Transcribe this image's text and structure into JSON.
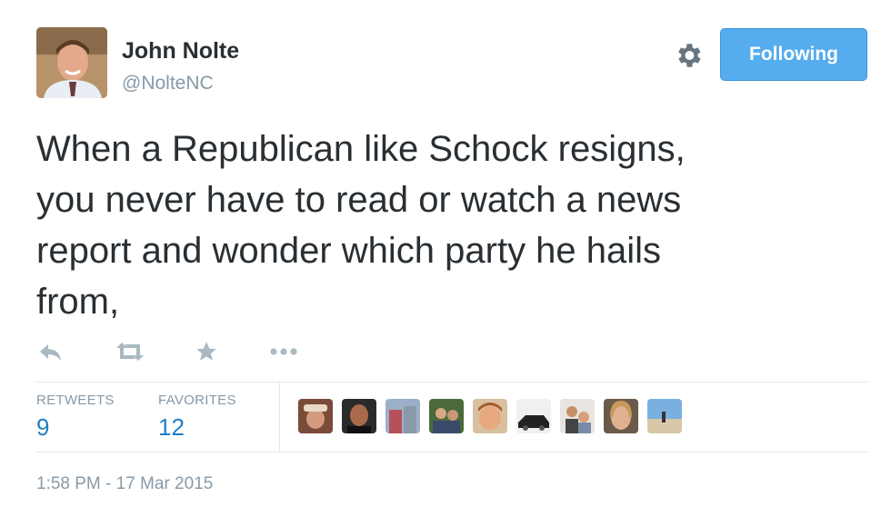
{
  "author": {
    "name": "John Nolte",
    "handle": "@NolteNC"
  },
  "follow_button": {
    "label": "Following",
    "color": "#55acee"
  },
  "settings_icon": "gear-icon",
  "tweet": {
    "lines": [
      "When a Republican like Schock resigns,",
      "you never have to read or watch a news",
      "report and wonder which party he hails",
      "from,"
    ]
  },
  "actions": [
    {
      "name": "reply-icon"
    },
    {
      "name": "retweet-icon"
    },
    {
      "name": "favorite-icon"
    },
    {
      "name": "more-icon"
    }
  ],
  "stats": {
    "retweets_label": "RETWEETS",
    "retweets_value": "9",
    "favorites_label": "FAVORITES",
    "favorites_value": "12"
  },
  "favoriters_count": 9,
  "timestamp": "1:58 PM - 17 Mar 2015",
  "colors": {
    "text": "#292f33",
    "muted": "#8899a6",
    "link": "#1f7ec4",
    "divider": "#e1e8ed"
  }
}
